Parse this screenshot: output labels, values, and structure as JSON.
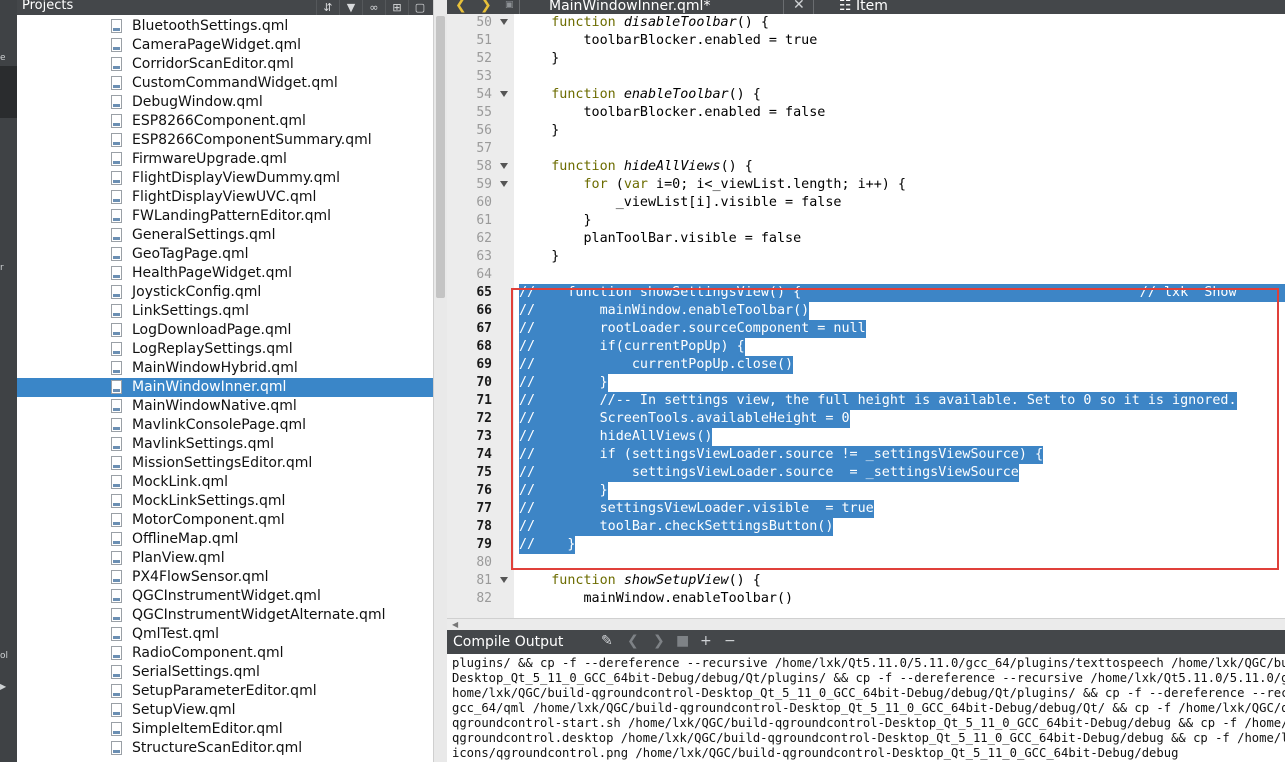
{
  "left_strip": {
    "marks": [
      "e",
      "r",
      "ol"
    ]
  },
  "projects": {
    "title": "Projects",
    "toolbar_icons": [
      "sort-icon",
      "filter-icon",
      "link-icon",
      "split-icon",
      "close-pane-icon"
    ],
    "files": [
      "BluetoothSettings.qml",
      "CameraPageWidget.qml",
      "CorridorScanEditor.qml",
      "CustomCommandWidget.qml",
      "DebugWindow.qml",
      "ESP8266Component.qml",
      "ESP8266ComponentSummary.qml",
      "FirmwareUpgrade.qml",
      "FlightDisplayViewDummy.qml",
      "FlightDisplayViewUVC.qml",
      "FWLandingPatternEditor.qml",
      "GeneralSettings.qml",
      "GeoTagPage.qml",
      "HealthPageWidget.qml",
      "JoystickConfig.qml",
      "LinkSettings.qml",
      "LogDownloadPage.qml",
      "LogReplaySettings.qml",
      "MainWindowHybrid.qml",
      "MainWindowInner.qml",
      "MainWindowNative.qml",
      "MavlinkConsolePage.qml",
      "MavlinkSettings.qml",
      "MissionSettingsEditor.qml",
      "MockLink.qml",
      "MockLinkSettings.qml",
      "MotorComponent.qml",
      "OfflineMap.qml",
      "PlanView.qml",
      "PX4FlowSensor.qml",
      "QGCInstrumentWidget.qml",
      "QGCInstrumentWidgetAlternate.qml",
      "QmlTest.qml",
      "RadioComponent.qml",
      "SerialSettings.qml",
      "SetupParameterEditor.qml",
      "SetupView.qml",
      "SimpleItemEditor.qml",
      "StructureScanEditor.qml"
    ],
    "selected_file": "MainWindowInner.qml"
  },
  "editor": {
    "filename": "MainWindowInner.qml*",
    "symbol": "Item",
    "lines": [
      {
        "n": "50",
        "text": "    function disableToolbar() {",
        "fold": true,
        "hl": false
      },
      {
        "n": "51",
        "text": "        toolbarBlocker.enabled = true",
        "fold": false,
        "hl": false
      },
      {
        "n": "52",
        "text": "    }",
        "fold": false,
        "hl": false
      },
      {
        "n": "53",
        "text": "",
        "fold": false,
        "hl": false
      },
      {
        "n": "54",
        "text": "    function enableToolbar() {",
        "fold": true,
        "hl": false
      },
      {
        "n": "55",
        "text": "        toolbarBlocker.enabled = false",
        "fold": false,
        "hl": false
      },
      {
        "n": "56",
        "text": "    }",
        "fold": false,
        "hl": false
      },
      {
        "n": "57",
        "text": "",
        "fold": false,
        "hl": false
      },
      {
        "n": "58",
        "text": "    function hideAllViews() {",
        "fold": true,
        "hl": false
      },
      {
        "n": "59",
        "text": "        for (var i=0; i<_viewList.length; i++) {",
        "fold": true,
        "hl": false
      },
      {
        "n": "60",
        "text": "            _viewList[i].visible = false",
        "fold": false,
        "hl": false
      },
      {
        "n": "61",
        "text": "        }",
        "fold": false,
        "hl": false
      },
      {
        "n": "62",
        "text": "        planToolBar.visible = false",
        "fold": false,
        "hl": false
      },
      {
        "n": "63",
        "text": "    }",
        "fold": false,
        "hl": false
      },
      {
        "n": "64",
        "text": "",
        "fold": false,
        "hl": false
      },
      {
        "n": "65",
        "text": "//    function showSettingsView() {                                          // lxk  Show",
        "fold": false,
        "hl": true
      },
      {
        "n": "66",
        "text": "//        mainWindow.enableToolbar()",
        "fold": false,
        "hl": true
      },
      {
        "n": "67",
        "text": "//        rootLoader.sourceComponent = null",
        "fold": false,
        "hl": true
      },
      {
        "n": "68",
        "text": "//        if(currentPopUp) {",
        "fold": false,
        "hl": true
      },
      {
        "n": "69",
        "text": "//            currentPopUp.close()",
        "fold": false,
        "hl": true
      },
      {
        "n": "70",
        "text": "//        }",
        "fold": false,
        "hl": true
      },
      {
        "n": "71",
        "text": "//        //-- In settings view, the full height is available. Set to 0 so it is ignored.",
        "fold": false,
        "hl": true
      },
      {
        "n": "72",
        "text": "//        ScreenTools.availableHeight = 0",
        "fold": false,
        "hl": true
      },
      {
        "n": "73",
        "text": "//        hideAllViews()",
        "fold": false,
        "hl": true
      },
      {
        "n": "74",
        "text": "//        if (settingsViewLoader.source != _settingsViewSource) {",
        "fold": false,
        "hl": true
      },
      {
        "n": "75",
        "text": "//            settingsViewLoader.source  = _settingsViewSource",
        "fold": false,
        "hl": true
      },
      {
        "n": "76",
        "text": "//        }",
        "fold": false,
        "hl": true
      },
      {
        "n": "77",
        "text": "//        settingsViewLoader.visible  = true",
        "fold": false,
        "hl": true
      },
      {
        "n": "78",
        "text": "//        toolBar.checkSettingsButton()",
        "fold": false,
        "hl": true
      },
      {
        "n": "79",
        "text": "//    }",
        "fold": false,
        "hl": true
      },
      {
        "n": "80",
        "text": "",
        "fold": false,
        "hl": false
      },
      {
        "n": "81",
        "text": "    function showSetupView() {",
        "fold": true,
        "hl": false
      },
      {
        "n": "82",
        "text": "        mainWindow.enableToolbar()",
        "fold": false,
        "hl": false
      }
    ]
  },
  "compile_output": {
    "title": "Compile Output",
    "lines": [
      "plugins/ && cp -f --dereference --recursive /home/lxk/Qt5.11.0/5.11.0/gcc_64/plugins/texttospeech /home/lxk/QGC/buil",
      "Desktop_Qt_5_11_0_GCC_64bit-Debug/debug/Qt/plugins/ && cp -f --dereference --recursive /home/lxk/Qt5.11.0/5.11.0/gcc",
      "home/lxk/QGC/build-qgroundcontrol-Desktop_Qt_5_11_0_GCC_64bit-Debug/debug/Qt/plugins/ && cp -f --dereference --recur",
      "gcc_64/qml /home/lxk/QGC/build-qgroundcontrol-Desktop_Qt_5_11_0_GCC_64bit-Debug/debug/Qt/ && cp -f /home/lxk/QGC/qgr",
      "qgroundcontrol-start.sh /home/lxk/QGC/build-qgroundcontrol-Desktop_Qt_5_11_0_GCC_64bit-Debug/debug && cp -f /home/lx",
      "qgroundcontrol.desktop /home/lxk/QGC/build-qgroundcontrol-Desktop_Qt_5_11_0_GCC_64bit-Debug/debug && cp -f /home/lxk",
      "icons/qgroundcontrol.png /home/lxk/QGC/build-qgroundcontrol-Desktop_Qt_5_11_0_GCC_64bit-Debug/debug"
    ]
  }
}
